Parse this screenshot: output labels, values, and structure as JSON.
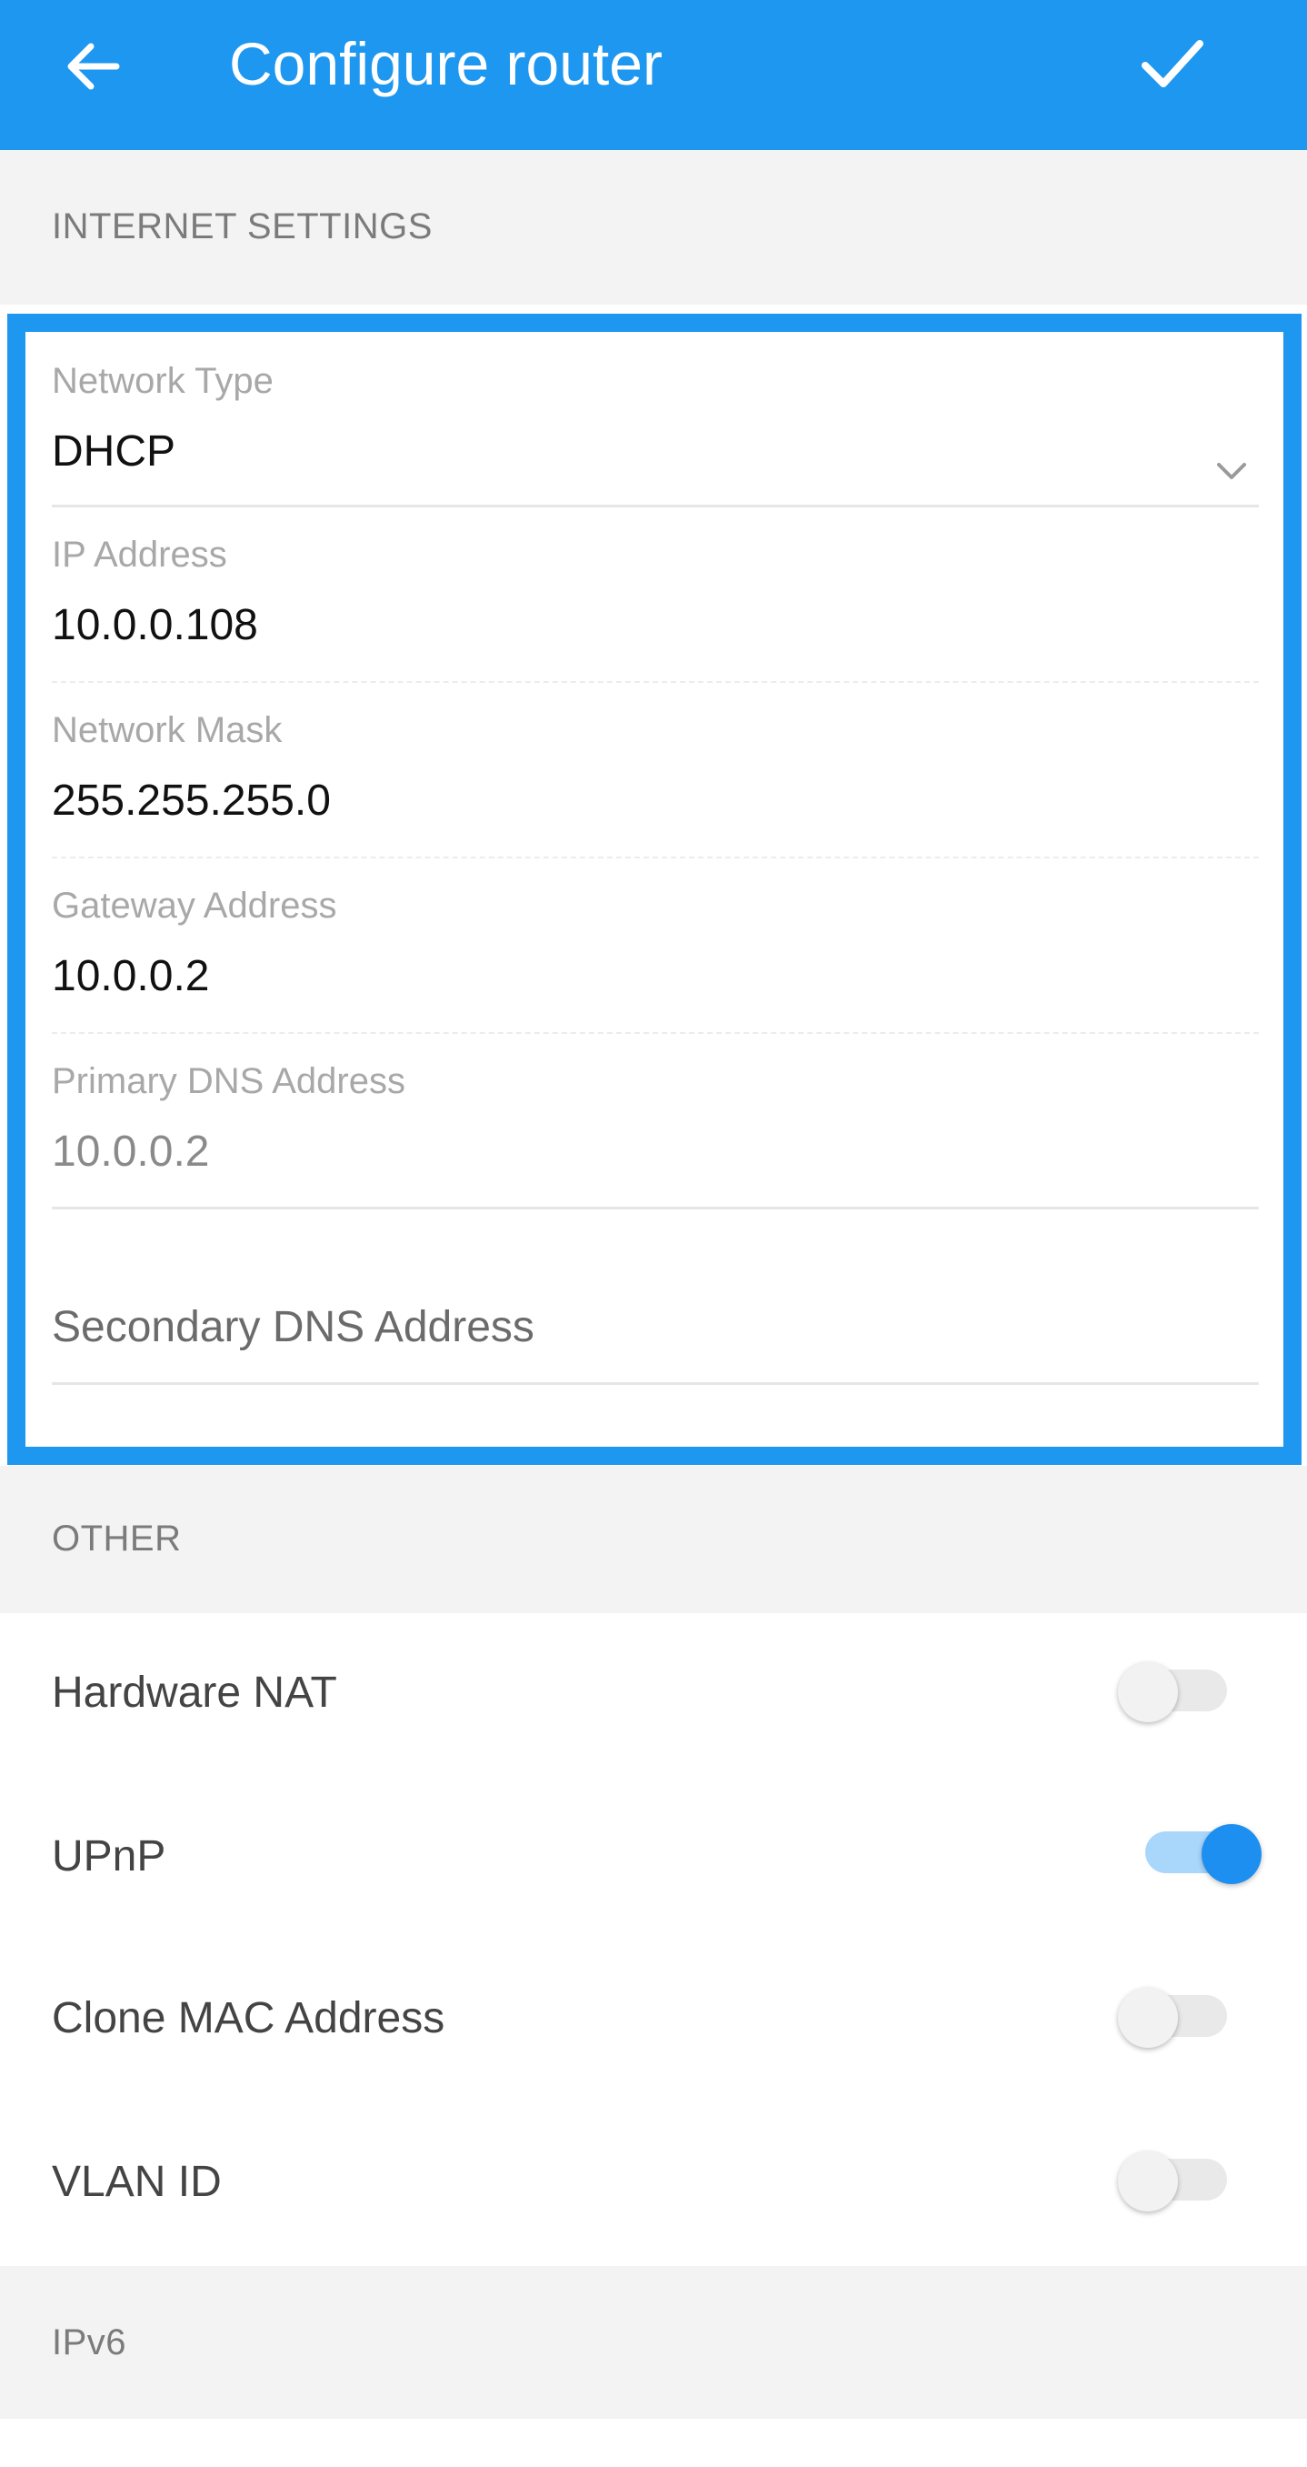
{
  "appbar": {
    "title": "Configure router",
    "back_icon": "arrow-left-icon",
    "confirm_icon": "checkmark-icon",
    "color": "#1d97ef"
  },
  "sections": {
    "internet": "INTERNET SETTINGS",
    "other": "OTHER",
    "ipv6": "IPv6"
  },
  "internet": {
    "network_type": {
      "label": "Network Type",
      "value": "DHCP",
      "icon": "chevron-down-icon"
    },
    "ip_address": {
      "label": "IP Address",
      "value": "10.0.0.108"
    },
    "network_mask": {
      "label": "Network Mask",
      "value": "255.255.255.0"
    },
    "gateway": {
      "label": "Gateway Address",
      "value": "10.0.0.2"
    },
    "primary_dns": {
      "label": "Primary DNS Address",
      "value": "10.0.0.2"
    },
    "secondary_dns": {
      "placeholder": "Secondary DNS Address"
    }
  },
  "other": {
    "items": [
      {
        "label": "Hardware NAT",
        "enabled": false
      },
      {
        "label": "UPnP",
        "enabled": true
      },
      {
        "label": "Clone MAC Address",
        "enabled": false
      },
      {
        "label": "VLAN ID",
        "enabled": false
      }
    ]
  },
  "colors": {
    "accent": "#1d97ef",
    "toggle_on_knob": "#1d8ff0",
    "toggle_on_track": "#a9d6fb"
  }
}
